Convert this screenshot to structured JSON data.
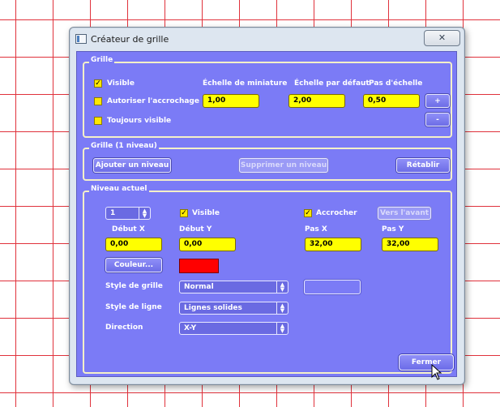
{
  "window": {
    "title": "Créateur de grille",
    "close_icon": "close-x"
  },
  "grille": {
    "legend": "Grille",
    "visible_label": "Visible",
    "visible_checked": true,
    "snap_label": "Autoriser l'accrochage",
    "snap_checked": false,
    "always_label": "Toujours visible",
    "always_checked": false,
    "col_thumb": "Échelle de miniature",
    "col_default": "Échelle par défaut",
    "col_step": "Pas d'échelle",
    "thumb_value": "1,00",
    "default_value": "2,00",
    "step_value": "0,50",
    "plus_label": "+",
    "minus_label": "-"
  },
  "levels": {
    "legend": "Grille (1 niveau)",
    "add_label": "Ajouter un niveau",
    "remove_label": "Supprimer un niveau",
    "reset_label": "Rétablir"
  },
  "current": {
    "legend": "Niveau actuel",
    "level_value": "1",
    "visible_label": "Visible",
    "visible_checked": true,
    "snap_label": "Accrocher",
    "snap_checked": true,
    "front_label": "Vers l'avant",
    "start_x_label": "Début X",
    "start_y_label": "Début Y",
    "step_x_label": "Pas X",
    "step_y_label": "Pas Y",
    "start_x_value": "0,00",
    "start_y_value": "0,00",
    "step_x_value": "32,00",
    "step_y_value": "32,00",
    "color_label": "Couleur...",
    "color_value": "#ff0000",
    "grid_style_label": "Style de grille",
    "grid_style_value": "Normal",
    "line_style_label": "Style de ligne",
    "line_style_value": "Lignes solides",
    "direction_label": "Direction",
    "direction_value": "X-Y"
  },
  "close_label": "Fermer",
  "colors": {
    "panel_bg": "#7b7bf6",
    "field_bg": "#ffff00",
    "grid_line": "#e0323c"
  }
}
